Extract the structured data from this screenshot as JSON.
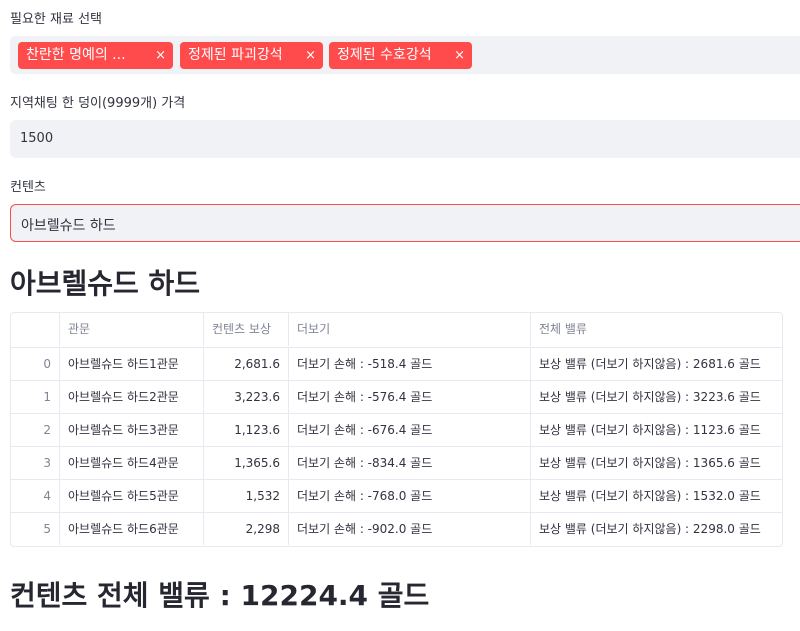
{
  "materials": {
    "label": "필요한 재료 선택",
    "selected": [
      "찬란한 명예의 ...",
      "정제된 파괴강석",
      "정제된 수호강석"
    ],
    "remove_glyph": "×"
  },
  "price": {
    "label": "지역채팅 한 덩이(9999개) 가격",
    "value": "1500"
  },
  "content": {
    "label": "컨텐츠",
    "value": "아브렐슈드 하드"
  },
  "section_title": "아브렐슈드 하드",
  "table": {
    "columns": [
      "",
      "관문",
      "컨텐츠 보상",
      "더보기",
      "전체 밸류"
    ],
    "rows": [
      [
        "0",
        "아브렐슈드 하드1관문",
        "2,681.6",
        "더보기 손해 : -518.4 골드",
        "보상 밸류 (더보기 하지않음) : 2681.6 골드"
      ],
      [
        "1",
        "아브렐슈드 하드2관문",
        "3,223.6",
        "더보기 손해 : -576.4 골드",
        "보상 밸류 (더보기 하지않음) : 3223.6 골드"
      ],
      [
        "2",
        "아브렐슈드 하드3관문",
        "1,123.6",
        "더보기 손해 : -676.4 골드",
        "보상 밸류 (더보기 하지않음) : 1123.6 골드"
      ],
      [
        "3",
        "아브렐슈드 하드4관문",
        "1,365.6",
        "더보기 손해 : -834.4 골드",
        "보상 밸류 (더보기 하지않음) : 1365.6 골드"
      ],
      [
        "4",
        "아브렐슈드 하드5관문",
        "1,532",
        "더보기 손해 : -768.0 골드",
        "보상 밸류 (더보기 하지않음) : 1532.0 골드"
      ],
      [
        "5",
        "아브렐슈드 하드6관문",
        "2,298",
        "더보기 손해 : -902.0 골드",
        "보상 밸류 (더보기 하지않음) : 2298.0 골드"
      ]
    ]
  },
  "total": "컨텐츠 전체 밸류 : 12224.4 골드",
  "colors": {
    "accent": "#ff4b4b",
    "field_bg": "#f0f2f6",
    "border": "#e6e9ef"
  }
}
